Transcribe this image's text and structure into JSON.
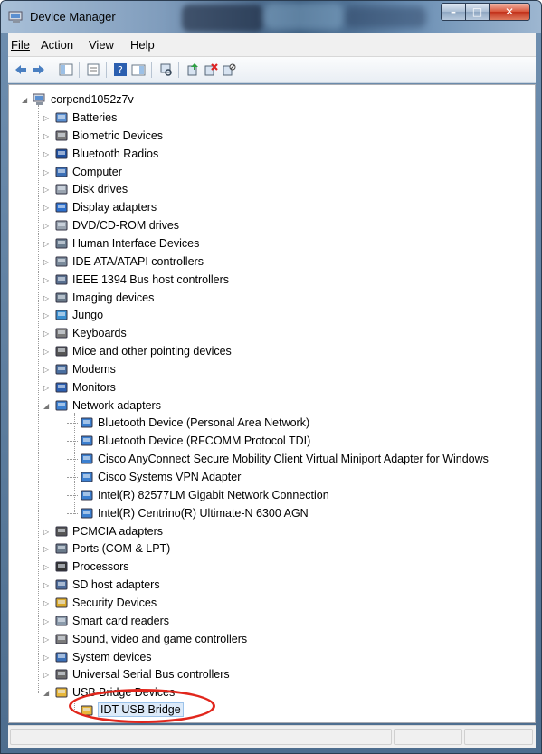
{
  "window": {
    "title": "Device Manager"
  },
  "menu": [
    {
      "key": "file",
      "label": "File"
    },
    {
      "key": "action",
      "label": "Action"
    },
    {
      "key": "view",
      "label": "View"
    },
    {
      "key": "help",
      "label": "Help"
    }
  ],
  "toolbar": [
    "back-arrow-icon",
    "forward-arrow-icon",
    "show-hide-console-tree-icon",
    "properties-icon",
    "help-icon",
    "action-pane-icon",
    "scan-hardware-icon",
    "update-driver-icon",
    "uninstall-device-icon",
    "disable-device-icon"
  ],
  "tree": {
    "root": "corpcnd1052z7v",
    "categories": [
      "Batteries",
      "Biometric Devices",
      "Bluetooth Radios",
      "Computer",
      "Disk drives",
      "Display adapters",
      "DVD/CD-ROM drives",
      "Human Interface Devices",
      "IDE ATA/ATAPI controllers",
      "IEEE 1394 Bus host controllers",
      "Imaging devices",
      "Jungo",
      "Keyboards",
      "Mice and other pointing devices",
      "Modems",
      "Monitors",
      "Network adapters"
    ],
    "network_adapters": [
      "Bluetooth Device (Personal Area Network)",
      "Bluetooth Device (RFCOMM Protocol TDI)",
      "Cisco AnyConnect Secure Mobility Client Virtual Miniport Adapter for Windows",
      "Cisco Systems VPN Adapter",
      "Intel(R) 82577LM Gigabit Network Connection",
      "Intel(R) Centrino(R) Ultimate-N 6300 AGN"
    ],
    "categories_after": [
      "PCMCIA adapters",
      "Ports (COM & LPT)",
      "Processors",
      "SD host adapters",
      "Security Devices",
      "Smart card readers",
      "Sound, video and game controllers",
      "System devices",
      "Universal Serial Bus controllers",
      "USB Bridge Devices"
    ],
    "usb_bridge_devices": [
      "IDT USB Bridge"
    ]
  },
  "colors": {
    "highlight_ring": "#e1261c",
    "selection": "#dceaf9"
  }
}
